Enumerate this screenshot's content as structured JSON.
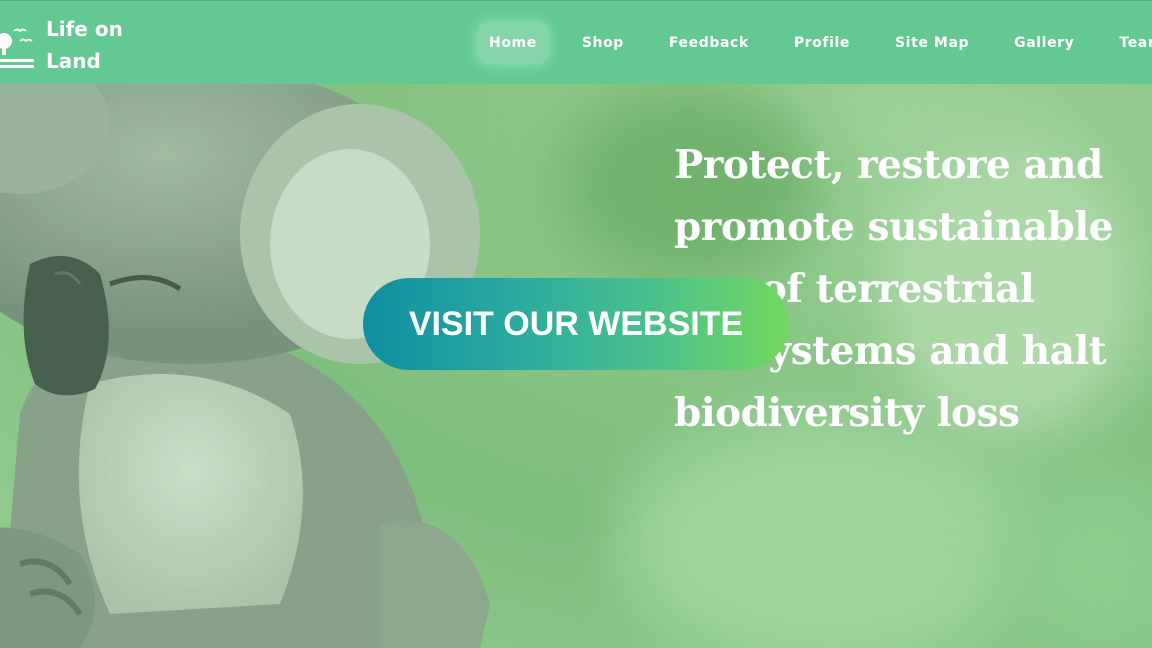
{
  "brand": {
    "name": "Life on\nLand",
    "logo_icon": "tree-and-birds-icon"
  },
  "nav": {
    "items": [
      {
        "label": "Home",
        "active": true
      },
      {
        "label": "Shop"
      },
      {
        "label": "Feedback"
      },
      {
        "label": "Profile"
      },
      {
        "label": "Site Map"
      },
      {
        "label": "Gallery"
      },
      {
        "label": "Team"
      }
    ]
  },
  "hero": {
    "headline_lines": [
      "Protect, restore and",
      "promote sustainable",
      "use of terrestrial",
      "ecosystems and halt",
      "biodiversity loss"
    ],
    "cta_label": "VISIT OUR WEBSITE",
    "image": "koala-photo"
  },
  "colors": {
    "navbar": "#64c892",
    "cta_gradient_start": "#0f8fa0",
    "cta_gradient_end": "#74d85e",
    "text": "#ffffff"
  }
}
